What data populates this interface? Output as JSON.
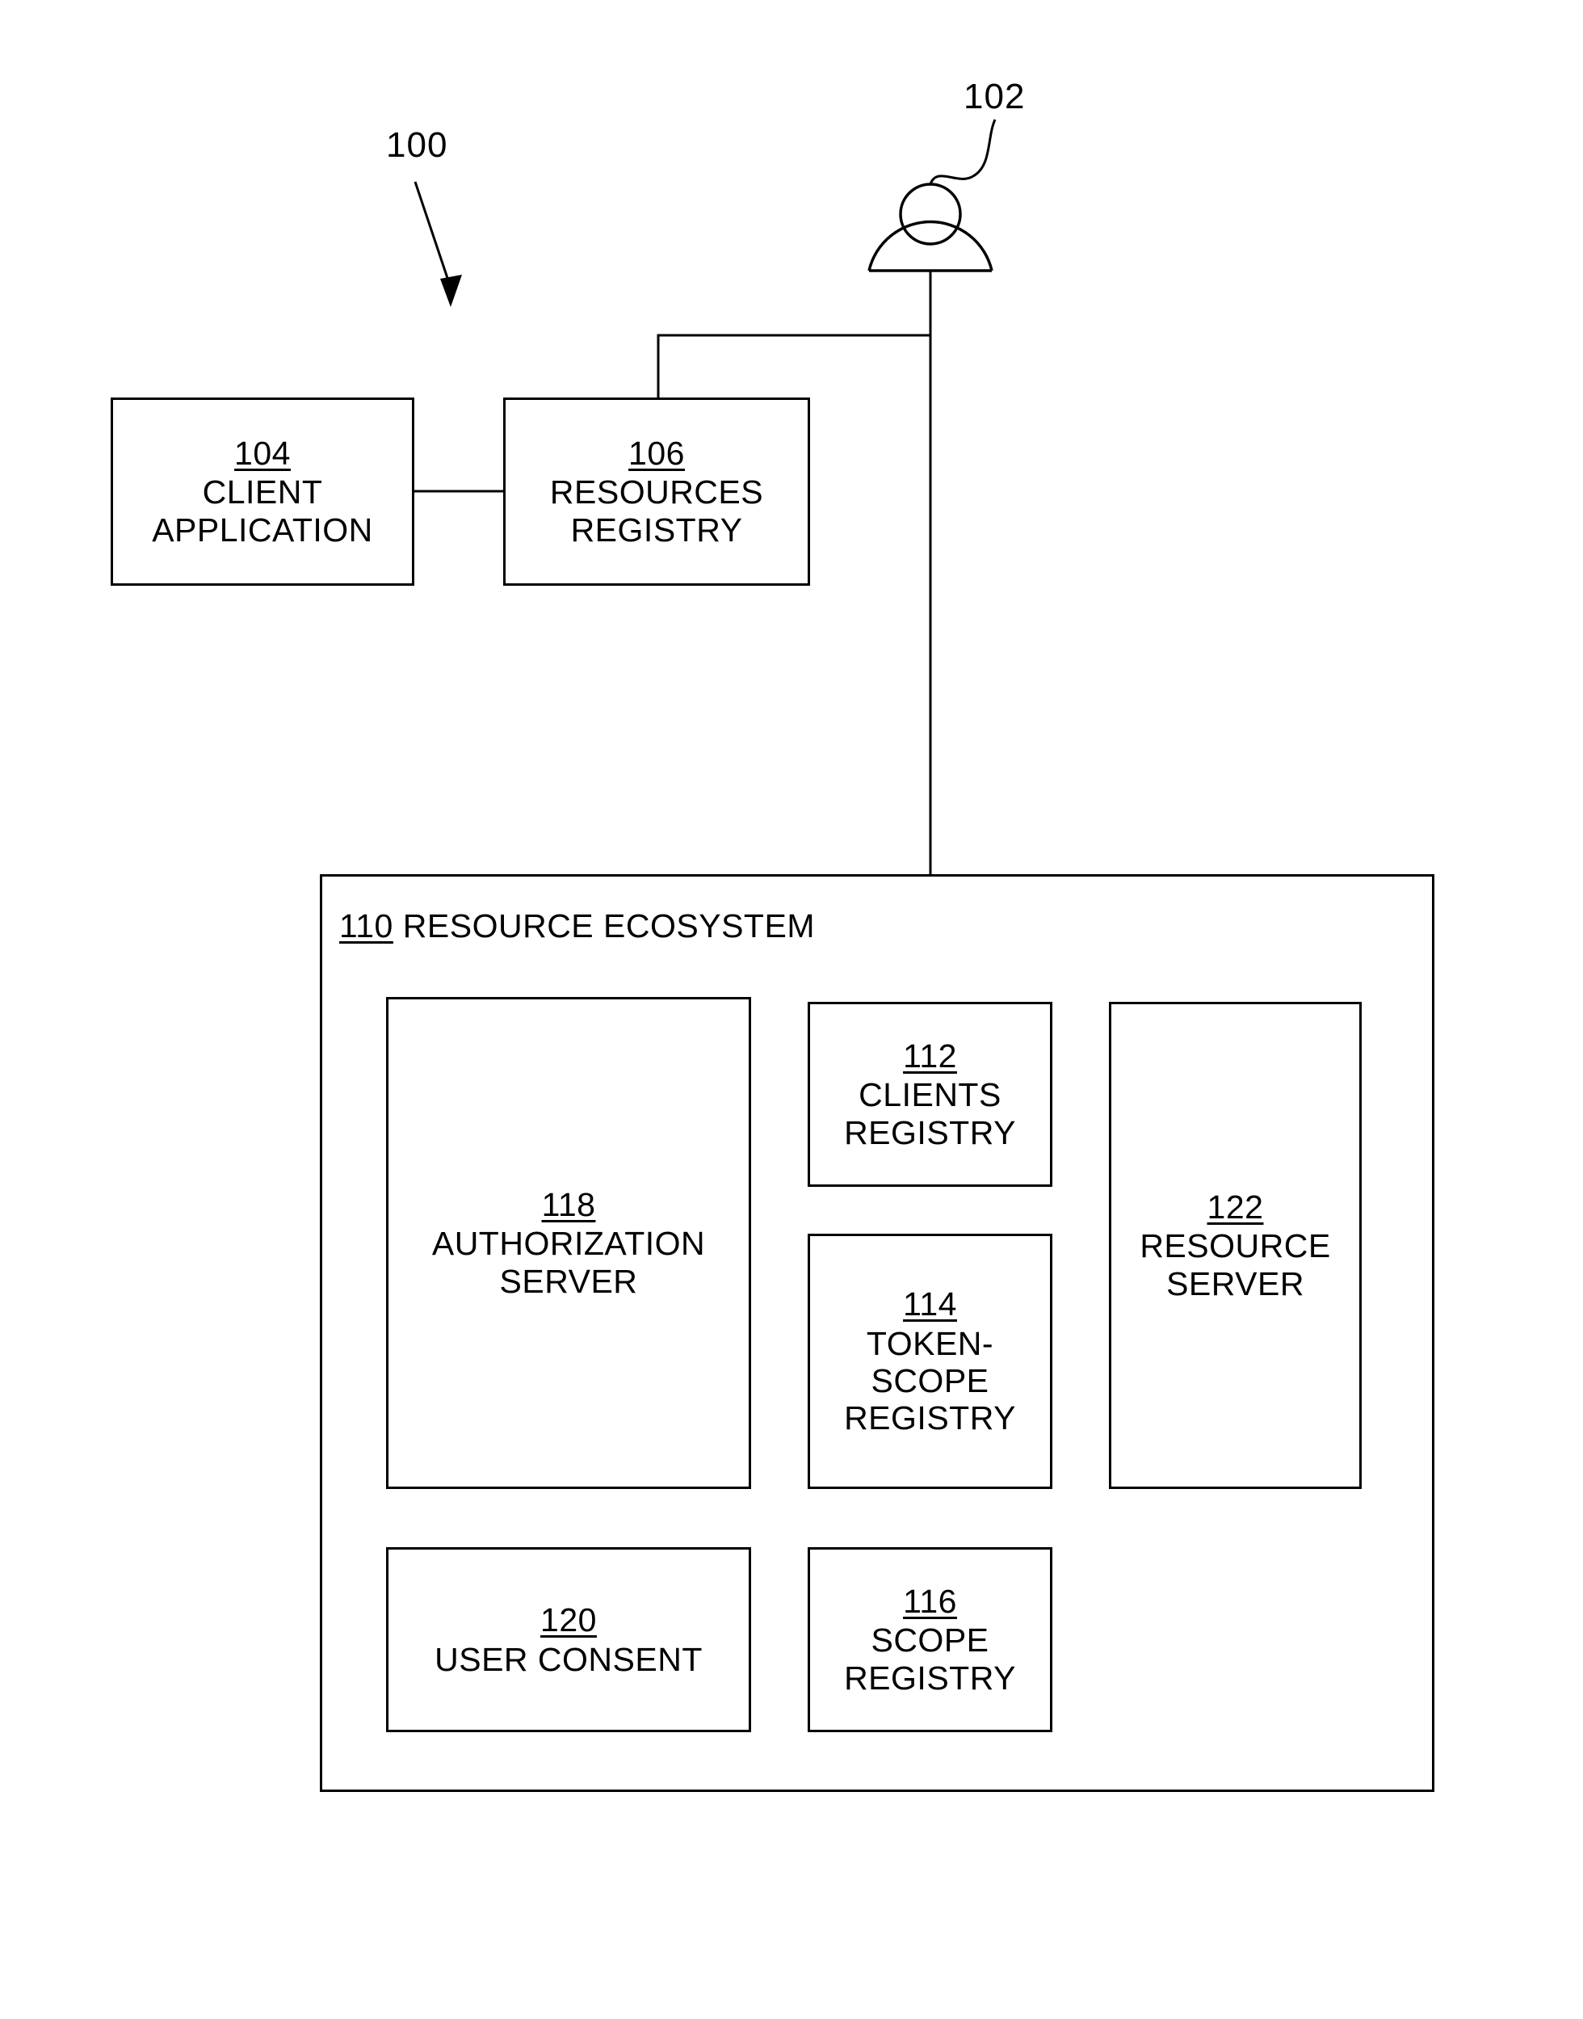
{
  "figure": {
    "number": "100",
    "actor_ref": "102",
    "actor_icon": "user-person-icon"
  },
  "nodes": {
    "client_application": {
      "ref": "104",
      "label": "CLIENT\nAPPLICATION"
    },
    "resources_registry": {
      "ref": "106",
      "label": "RESOURCES\nREGISTRY"
    },
    "clients_registry": {
      "ref": "112",
      "label": "CLIENTS\nREGISTRY"
    },
    "token_scope_registry": {
      "ref": "114",
      "label": "TOKEN-\nSCOPE\nREGISTRY"
    },
    "scope_registry": {
      "ref": "116",
      "label": "SCOPE\nREGISTRY"
    },
    "authorization_server": {
      "ref": "118",
      "label": "AUTHORIZATION\nSERVER"
    },
    "user_consent": {
      "ref": "120",
      "label": "USER CONSENT"
    },
    "resource_server": {
      "ref": "122",
      "label": "RESOURCE\nSERVER"
    }
  },
  "container": {
    "ref": "110",
    "label": "RESOURCE ECOSYSTEM"
  },
  "colors": {
    "stroke": "#000000",
    "background": "#ffffff"
  }
}
